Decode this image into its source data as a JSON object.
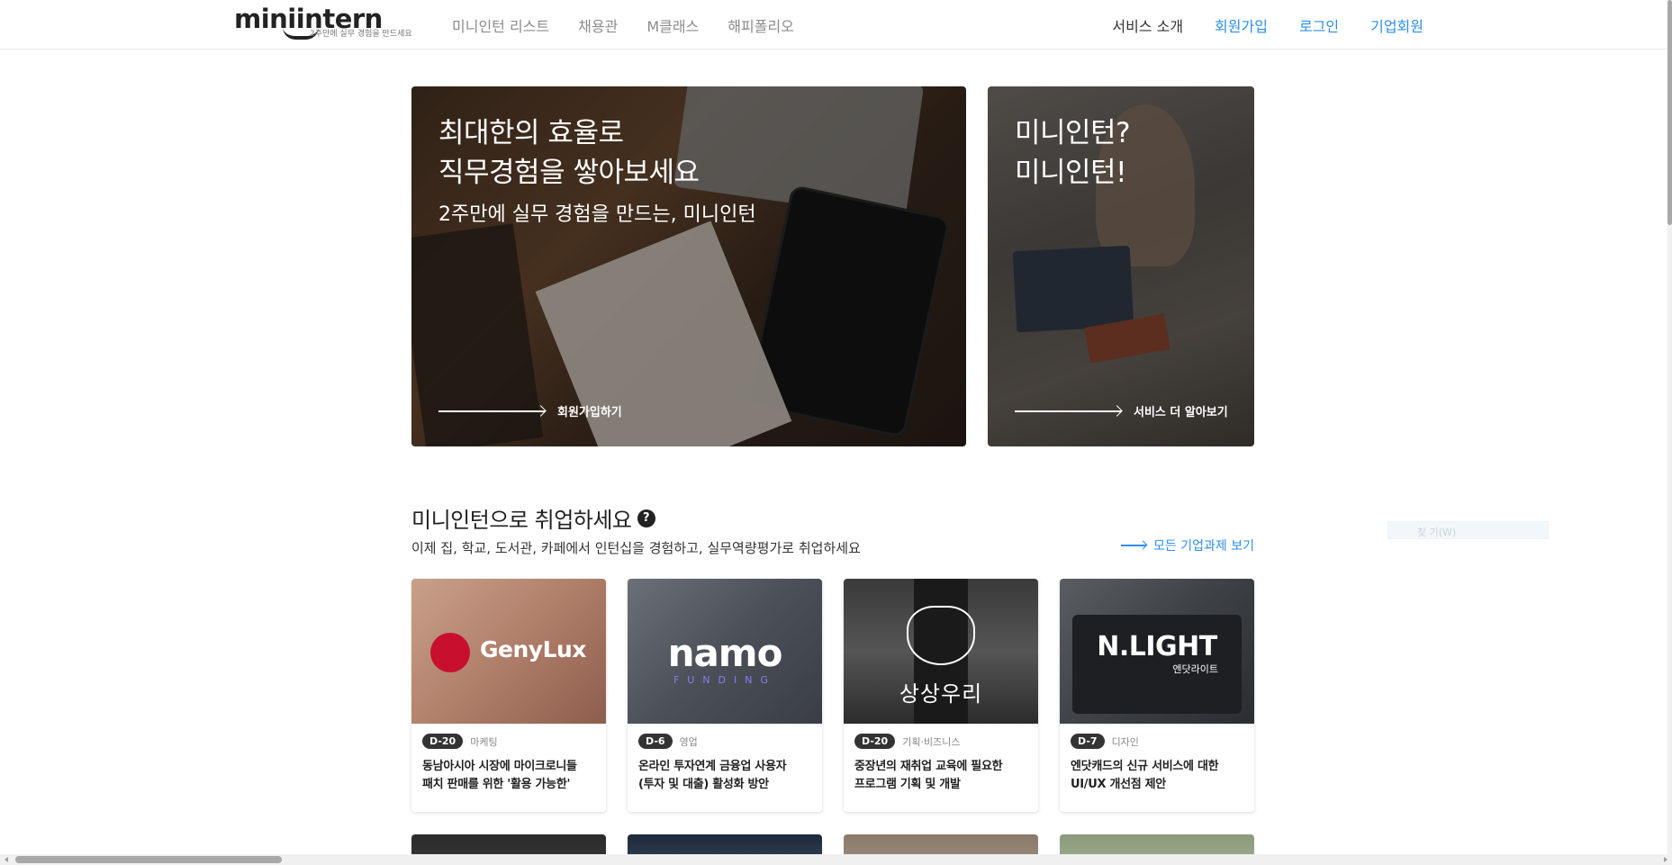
{
  "header": {
    "logo_text": "miniintern",
    "logo_tagline": "2주만에 실무 경험을 만드세요",
    "nav_left": [
      "미니인턴 리스트",
      "채용관",
      "M클래스",
      "해피폴리오"
    ],
    "nav_right": [
      "서비스 소개",
      "회원가입",
      "로그인",
      "기업회원"
    ]
  },
  "hero": {
    "main": {
      "title_line1": "최대한의 효율로",
      "title_line2": "직무경험을 쌓아보세요",
      "subtitle": "2주만에 실무 경험을 만드는, 미니인턴",
      "link": "회원가입하기"
    },
    "side": {
      "title_line1": "미니인턴?",
      "title_line2": "미니인턴!",
      "link": "서비스 더 알아보기"
    }
  },
  "section": {
    "title": "미니인턴으로 취업하세요",
    "help_icon": "?",
    "subtitle": "이제 집, 학교, 도서관, 카페에서 인턴십을 경험하고, 실무역량평가로 취업하세요",
    "view_all": "모든 기업과제 보기"
  },
  "find_box": "찾 기(W)",
  "cards": [
    {
      "brand": "GenyLux",
      "dday": "D-20",
      "category": "마케팅",
      "title_line1": "동남아시아 시장에 마이크로니들",
      "title_line2": "패치 판매를 위한 '활용 가능한'"
    },
    {
      "brand": "namo",
      "brand_sub": "FUNDING",
      "dday": "D-6",
      "category": "영업",
      "title_line1": "온라인 투자연계 금융업 사용자",
      "title_line2": "(투자 및 대출) 활성화 방안"
    },
    {
      "brand": "상상우리",
      "dday": "D-20",
      "category": "기획·비즈니스",
      "title_line1": "중장년의 재취업 교육에 필요한",
      "title_line2": "프로그램 기획 및 개발"
    },
    {
      "brand": "N.LIGHT",
      "brand_sub": "엔닷라이트",
      "dday": "D-7",
      "category": "디자인",
      "title_line1": "엔닷캐드의 신규 서비스에 대한",
      "title_line2": "UI/UX 개선점 제안"
    }
  ],
  "colors": {
    "accent": "#2e8ee8",
    "badge": "#333333"
  }
}
